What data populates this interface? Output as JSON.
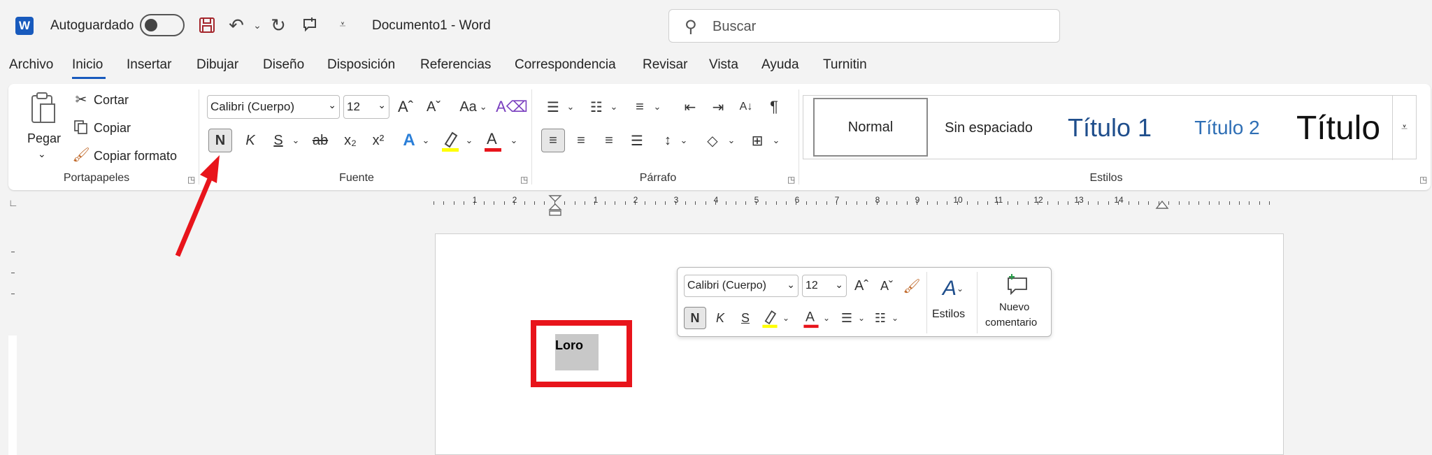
{
  "titlebar": {
    "logo": "W",
    "autosave_label": "Autoguardado",
    "doc_title": "Documento1  -  Word",
    "search_placeholder": "Buscar"
  },
  "menu": {
    "items": [
      "Archivo",
      "Inicio",
      "Insertar",
      "Dibujar",
      "Diseño",
      "Disposición",
      "Referencias",
      "Correspondencia",
      "Revisar",
      "Vista",
      "Ayuda",
      "Turnitin"
    ],
    "active": "Inicio"
  },
  "ribbon": {
    "clipboard": {
      "paste_label": "Pegar",
      "cut_label": "Cortar",
      "copy_label": "Copiar",
      "format_painter_label": "Copiar formato",
      "group_label": "Portapapeles"
    },
    "font": {
      "font_name": "Calibri (Cuerpo)",
      "font_size": "12",
      "bold": "N",
      "italic": "K",
      "underline": "S",
      "strike": "ab",
      "subscript": "x₂",
      "superscript": "x²",
      "change_case": "Aa",
      "group_label": "Fuente"
    },
    "paragraph": {
      "group_label": "Párrafo"
    },
    "styles": {
      "items": [
        "Normal",
        "Sin espaciado",
        "Título 1",
        "Título 2",
        "Título"
      ],
      "group_label": "Estilos"
    }
  },
  "ruler": {
    "numbers": [
      "1",
      "2",
      "1",
      "2",
      "3",
      "4",
      "5",
      "6",
      "7",
      "8",
      "9",
      "10",
      "11",
      "12",
      "13",
      "14"
    ]
  },
  "document": {
    "selected_text": "Loro"
  },
  "mini_toolbar": {
    "font_name": "Calibri (Cuerpo)",
    "font_size": "12",
    "bold": "N",
    "italic": "K",
    "underline": "S",
    "styles_label": "Estilos",
    "new_comment_line1": "Nuevo",
    "new_comment_line2": "comentario"
  },
  "colors": {
    "accent": "#185abd",
    "annotation_red": "#e8141b",
    "highlight_yellow": "#ffff00",
    "font_red": "#e8141b"
  }
}
